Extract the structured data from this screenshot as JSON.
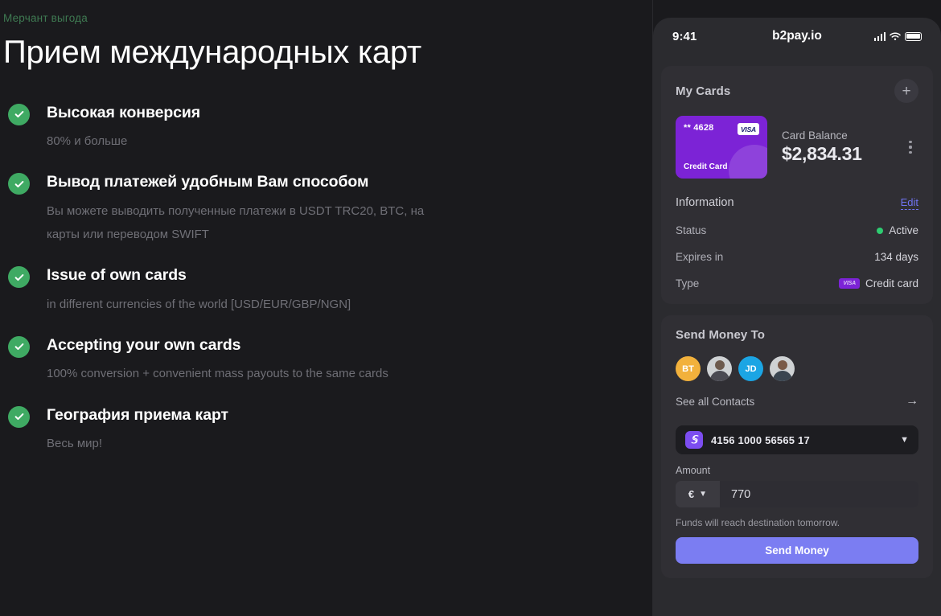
{
  "left": {
    "eyebrow": "Мерчант выгода",
    "title": "Прием международных карт",
    "features": [
      {
        "title": "Высокая конверсия",
        "desc": "80% и больше"
      },
      {
        "title": "Вывод платежей удобным Вам способом",
        "desc": "Вы можете выводить полученные платежи в USDT TRC20, BTC, на карты или переводом SWIFT"
      },
      {
        "title": "Issue of own cards",
        "desc": "in different currencies of the world [USD/EUR/GBP/NGN]"
      },
      {
        "title": "Accepting your own cards",
        "desc": "100% conversion + convenient mass payouts to the same cards"
      },
      {
        "title": "География приема карт",
        "desc": "Весь мир!"
      }
    ]
  },
  "phone": {
    "statusbar": {
      "time": "9:41",
      "title": "b2pay.io"
    },
    "cards_panel": {
      "heading": "My Cards",
      "add_label": "+",
      "card": {
        "number": "** 4628",
        "brand": "VISA",
        "type": "Credit Card"
      },
      "balance_label": "Card Balance",
      "balance_value": "$2,834.31",
      "information": {
        "title": "Information",
        "edit_label": "Edit",
        "rows": [
          {
            "key": "Status",
            "value": "Active"
          },
          {
            "key": "Expires in",
            "value": "134 days"
          },
          {
            "key": "Type",
            "value": "Credit card",
            "badge": "VISA"
          }
        ]
      }
    },
    "send_panel": {
      "heading": "Send Money To",
      "contacts": [
        {
          "initials": "BT",
          "kind": "initials"
        },
        {
          "initials": "",
          "kind": "photo-male"
        },
        {
          "initials": "JD",
          "kind": "initials"
        },
        {
          "initials": "",
          "kind": "photo-female"
        }
      ],
      "see_all_label": "See all Contacts",
      "account_select": {
        "value": "4156 1000 56565 17"
      },
      "amount_label": "Amount",
      "currency": "€",
      "amount_value": "770",
      "funds_note": "Funds will reach destination tomorrow.",
      "send_button": "Send Money"
    }
  },
  "colors": {
    "background": "#1a1a1d",
    "check_green": "#3faa63",
    "eyebrow_green": "#3f7a52",
    "card_purple": "#7c23d6",
    "accent_indigo": "#7b7df2",
    "status_green": "#2ecc71"
  }
}
